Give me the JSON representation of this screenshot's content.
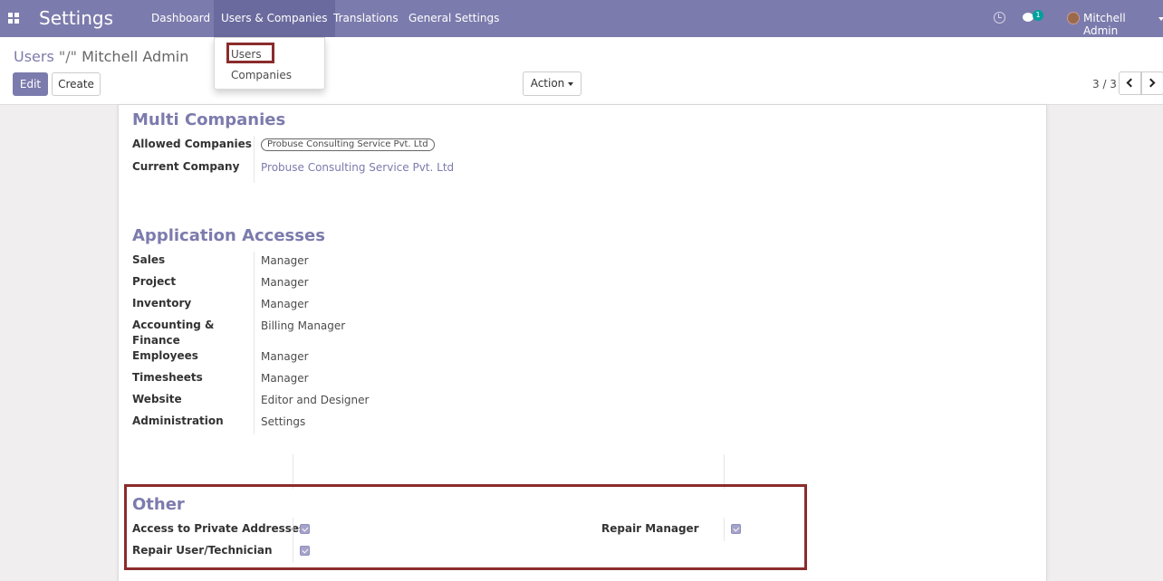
{
  "navbar": {
    "app_title": "Settings",
    "menu": [
      "Dashboard",
      "Users & Companies",
      "Translations",
      "General Settings"
    ],
    "active_menu": "Users & Companies",
    "chat_badge": "1",
    "user_name": "Mitchell Admin",
    "color": "#7c7bad"
  },
  "dropdown": {
    "items": [
      "Users",
      "Companies"
    ],
    "highlighted": "Users"
  },
  "breadcrumb": {
    "parent": "Users",
    "separator": "\"/\"",
    "current": "Mitchell Admin"
  },
  "buttons": {
    "edit": "Edit",
    "create": "Create",
    "action": "Action"
  },
  "pager": {
    "value": "3 / 3"
  },
  "multi_companies": {
    "title": "Multi Companies",
    "fields": [
      {
        "label": "Allowed Companies",
        "value": "Probuse Consulting Service Pvt. Ltd"
      },
      {
        "label": "Current Company",
        "value": "Probuse Consulting Service Pvt. Ltd"
      }
    ]
  },
  "application_accesses": {
    "title": "Application Accesses",
    "fields": [
      {
        "label": "Sales",
        "value": "Manager"
      },
      {
        "label": "Project",
        "value": "Manager"
      },
      {
        "label": "Inventory",
        "value": "Manager"
      },
      {
        "label": "Accounting &",
        "label2": "Finance",
        "value": "Billing Manager"
      },
      {
        "label": "Employees",
        "value": "Manager"
      },
      {
        "label": "Timesheets",
        "value": "Manager"
      },
      {
        "label": "Website",
        "value": "Editor and Designer"
      },
      {
        "label": "Administration",
        "value": "Settings"
      }
    ]
  },
  "other": {
    "title": "Other",
    "fields": [
      {
        "label": "Access to Private Addresses",
        "checked": true
      },
      {
        "label": "Repair Manager",
        "checked": true
      },
      {
        "label": "Repair User/Technician",
        "checked": true
      }
    ]
  }
}
